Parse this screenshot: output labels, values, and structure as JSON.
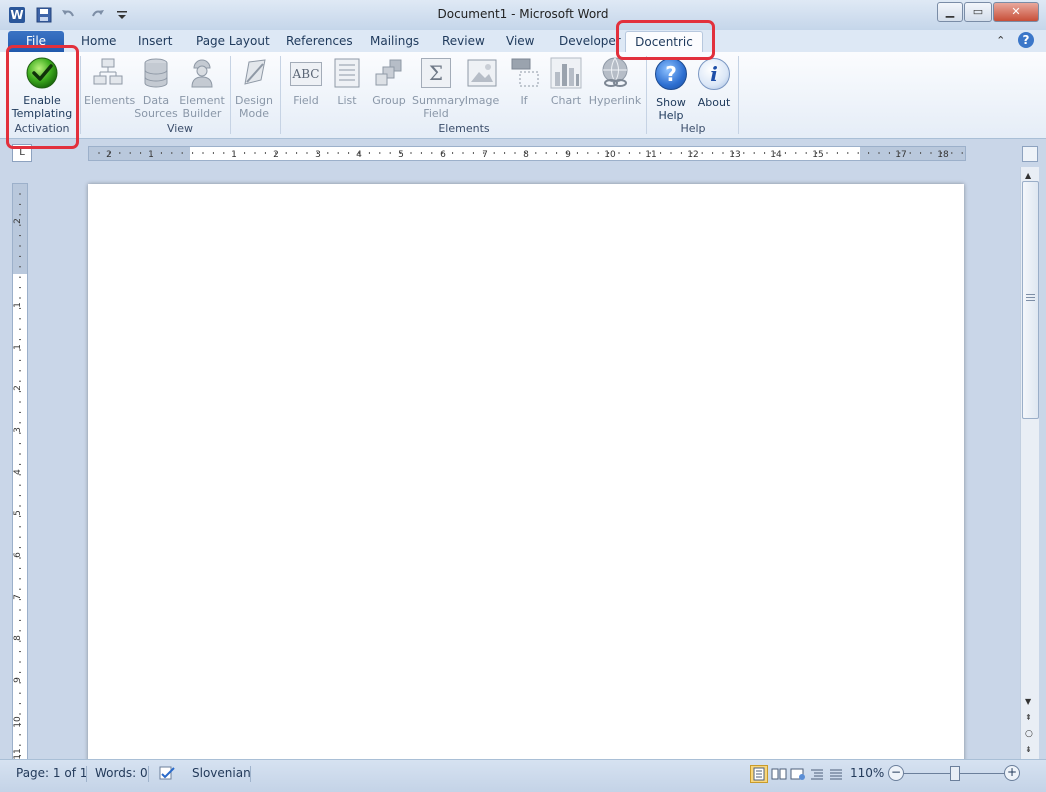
{
  "window": {
    "title": "Document1  -  Microsoft Word",
    "app_icon_letter": "W",
    "quick_access": [
      "save-icon",
      "undo-icon",
      "redo-icon",
      "customize-icon"
    ],
    "controls": {
      "minimize": "▁",
      "maximize": "▭",
      "close": "✕"
    }
  },
  "ribbon_tabs": {
    "file": "File",
    "home": "Home",
    "insert": "Insert",
    "page_layout": "Page Layout",
    "references": "References",
    "mailings": "Mailings",
    "review": "Review",
    "view": "View",
    "developer": "Developer",
    "docentric": "Docentric",
    "active": "Docentric"
  },
  "help": {
    "minimize_ribbon": "⌃",
    "help_glyph": "?"
  },
  "ribbon": {
    "activation": {
      "label": "Activation",
      "enable_templating": {
        "line1": "Enable",
        "line2": "Templating"
      }
    },
    "view": {
      "label": "View",
      "elements": {
        "line1": "Elements"
      },
      "data_sources": {
        "line1": "Data",
        "line2": "Sources"
      },
      "element_builder": {
        "line1": "Element",
        "line2": "Builder"
      },
      "design_mode": {
        "line1": "Design",
        "line2": "Mode"
      }
    },
    "elements": {
      "label": "Elements",
      "field": {
        "line1": "Field",
        "icon_text": "ABC"
      },
      "list": {
        "line1": "List"
      },
      "group": {
        "line1": "Group"
      },
      "summary_field": {
        "line1": "Summary",
        "line2": "Field",
        "icon_text": "Σ"
      },
      "image": {
        "line1": "Image"
      },
      "if": {
        "line1": "If"
      },
      "chart": {
        "line1": "Chart"
      },
      "hyperlink": {
        "line1": "Hyperlink"
      }
    },
    "help": {
      "label": "Help",
      "show_help": {
        "line1": "Show",
        "line2": "Help",
        "icon_text": "?"
      },
      "about": {
        "line1": "About",
        "icon_text": "i"
      }
    }
  },
  "ruler": {
    "tab_selector": "L",
    "h_marks": [
      "2",
      "1",
      "1",
      "2",
      "3",
      "4",
      "5",
      "6",
      "7",
      "8",
      "9",
      "10",
      "11",
      "12",
      "13",
      "14",
      "15",
      "17",
      "18"
    ],
    "v_marks": [
      "2",
      "1",
      "1",
      "2",
      "3",
      "4",
      "5",
      "6",
      "7",
      "8",
      "9",
      "10",
      "11"
    ]
  },
  "status": {
    "page": "Page: 1 of 1",
    "words": "Words: 0",
    "language": "Slovenian",
    "zoom": "110%",
    "zoom_out": "−",
    "zoom_in": "+",
    "zoom_fraction": 0.52
  },
  "colors": {
    "highlight": "#e2303c",
    "accent": "#2b579a"
  }
}
